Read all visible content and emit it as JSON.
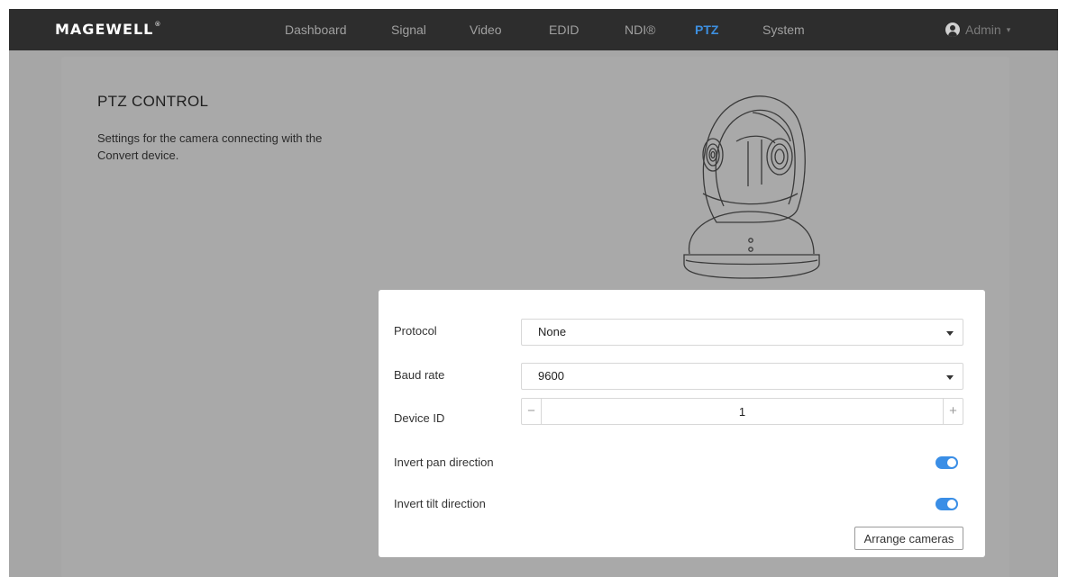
{
  "brand": {
    "logo": "MAGEWELL",
    "mark": "®"
  },
  "nav": {
    "items": [
      {
        "label": "Dashboard",
        "active": false
      },
      {
        "label": "Signal",
        "active": false
      },
      {
        "label": "Video",
        "active": false
      },
      {
        "label": "EDID",
        "active": false
      },
      {
        "label": "NDI®",
        "active": false
      },
      {
        "label": "PTZ",
        "active": true
      },
      {
        "label": "System",
        "active": false
      }
    ],
    "user": {
      "name": "Admin",
      "icon": "user-icon",
      "caret": "▾"
    }
  },
  "section": {
    "title": "PTZ CONTROL",
    "description": "Settings for the camera connecting with the Convert device."
  },
  "form": {
    "protocol": {
      "label": "Protocol",
      "value": "None"
    },
    "baud_rate": {
      "label": "Baud rate",
      "value": "9600"
    },
    "device_id": {
      "label": "Device ID",
      "value": "1",
      "minus": "−",
      "plus": "+"
    },
    "invert_pan": {
      "label": "Invert pan direction",
      "enabled": true
    },
    "invert_tilt": {
      "label": "Invert tilt direction",
      "enabled": true
    },
    "arrange_button": "Arrange cameras"
  },
  "colors": {
    "accent": "#3a8ee6",
    "navbar": "#2d2d2d",
    "overlay": "#a6a6a6"
  }
}
